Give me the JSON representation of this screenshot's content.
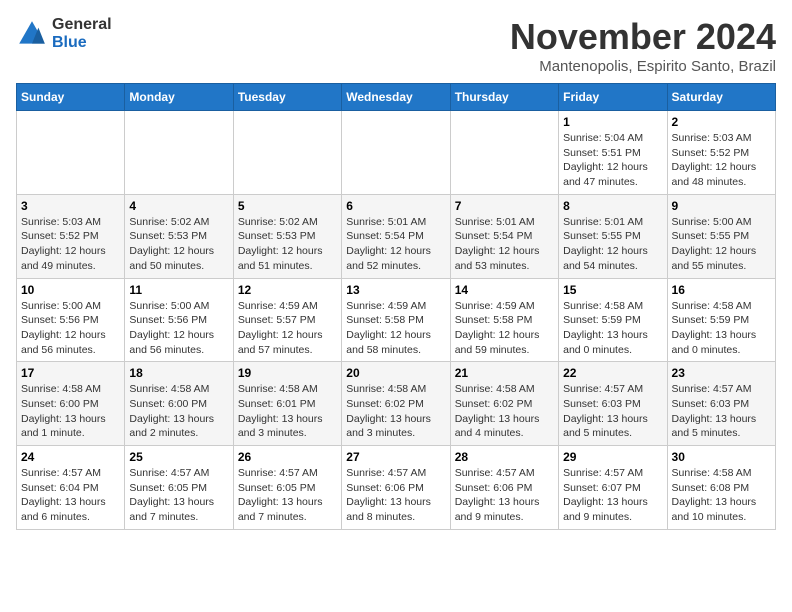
{
  "logo": {
    "general": "General",
    "blue": "Blue"
  },
  "title": {
    "month": "November 2024",
    "location": "Mantenopolis, Espirito Santo, Brazil"
  },
  "weekdays": [
    "Sunday",
    "Monday",
    "Tuesday",
    "Wednesday",
    "Thursday",
    "Friday",
    "Saturday"
  ],
  "weeks": [
    [
      {
        "day": "",
        "info": ""
      },
      {
        "day": "",
        "info": ""
      },
      {
        "day": "",
        "info": ""
      },
      {
        "day": "",
        "info": ""
      },
      {
        "day": "",
        "info": ""
      },
      {
        "day": "1",
        "info": "Sunrise: 5:04 AM\nSunset: 5:51 PM\nDaylight: 12 hours and 47 minutes."
      },
      {
        "day": "2",
        "info": "Sunrise: 5:03 AM\nSunset: 5:52 PM\nDaylight: 12 hours and 48 minutes."
      }
    ],
    [
      {
        "day": "3",
        "info": "Sunrise: 5:03 AM\nSunset: 5:52 PM\nDaylight: 12 hours and 49 minutes."
      },
      {
        "day": "4",
        "info": "Sunrise: 5:02 AM\nSunset: 5:53 PM\nDaylight: 12 hours and 50 minutes."
      },
      {
        "day": "5",
        "info": "Sunrise: 5:02 AM\nSunset: 5:53 PM\nDaylight: 12 hours and 51 minutes."
      },
      {
        "day": "6",
        "info": "Sunrise: 5:01 AM\nSunset: 5:54 PM\nDaylight: 12 hours and 52 minutes."
      },
      {
        "day": "7",
        "info": "Sunrise: 5:01 AM\nSunset: 5:54 PM\nDaylight: 12 hours and 53 minutes."
      },
      {
        "day": "8",
        "info": "Sunrise: 5:01 AM\nSunset: 5:55 PM\nDaylight: 12 hours and 54 minutes."
      },
      {
        "day": "9",
        "info": "Sunrise: 5:00 AM\nSunset: 5:55 PM\nDaylight: 12 hours and 55 minutes."
      }
    ],
    [
      {
        "day": "10",
        "info": "Sunrise: 5:00 AM\nSunset: 5:56 PM\nDaylight: 12 hours and 56 minutes."
      },
      {
        "day": "11",
        "info": "Sunrise: 5:00 AM\nSunset: 5:56 PM\nDaylight: 12 hours and 56 minutes."
      },
      {
        "day": "12",
        "info": "Sunrise: 4:59 AM\nSunset: 5:57 PM\nDaylight: 12 hours and 57 minutes."
      },
      {
        "day": "13",
        "info": "Sunrise: 4:59 AM\nSunset: 5:58 PM\nDaylight: 12 hours and 58 minutes."
      },
      {
        "day": "14",
        "info": "Sunrise: 4:59 AM\nSunset: 5:58 PM\nDaylight: 12 hours and 59 minutes."
      },
      {
        "day": "15",
        "info": "Sunrise: 4:58 AM\nSunset: 5:59 PM\nDaylight: 13 hours and 0 minutes."
      },
      {
        "day": "16",
        "info": "Sunrise: 4:58 AM\nSunset: 5:59 PM\nDaylight: 13 hours and 0 minutes."
      }
    ],
    [
      {
        "day": "17",
        "info": "Sunrise: 4:58 AM\nSunset: 6:00 PM\nDaylight: 13 hours and 1 minute."
      },
      {
        "day": "18",
        "info": "Sunrise: 4:58 AM\nSunset: 6:00 PM\nDaylight: 13 hours and 2 minutes."
      },
      {
        "day": "19",
        "info": "Sunrise: 4:58 AM\nSunset: 6:01 PM\nDaylight: 13 hours and 3 minutes."
      },
      {
        "day": "20",
        "info": "Sunrise: 4:58 AM\nSunset: 6:02 PM\nDaylight: 13 hours and 3 minutes."
      },
      {
        "day": "21",
        "info": "Sunrise: 4:58 AM\nSunset: 6:02 PM\nDaylight: 13 hours and 4 minutes."
      },
      {
        "day": "22",
        "info": "Sunrise: 4:57 AM\nSunset: 6:03 PM\nDaylight: 13 hours and 5 minutes."
      },
      {
        "day": "23",
        "info": "Sunrise: 4:57 AM\nSunset: 6:03 PM\nDaylight: 13 hours and 5 minutes."
      }
    ],
    [
      {
        "day": "24",
        "info": "Sunrise: 4:57 AM\nSunset: 6:04 PM\nDaylight: 13 hours and 6 minutes."
      },
      {
        "day": "25",
        "info": "Sunrise: 4:57 AM\nSunset: 6:05 PM\nDaylight: 13 hours and 7 minutes."
      },
      {
        "day": "26",
        "info": "Sunrise: 4:57 AM\nSunset: 6:05 PM\nDaylight: 13 hours and 7 minutes."
      },
      {
        "day": "27",
        "info": "Sunrise: 4:57 AM\nSunset: 6:06 PM\nDaylight: 13 hours and 8 minutes."
      },
      {
        "day": "28",
        "info": "Sunrise: 4:57 AM\nSunset: 6:06 PM\nDaylight: 13 hours and 9 minutes."
      },
      {
        "day": "29",
        "info": "Sunrise: 4:57 AM\nSunset: 6:07 PM\nDaylight: 13 hours and 9 minutes."
      },
      {
        "day": "30",
        "info": "Sunrise: 4:58 AM\nSunset: 6:08 PM\nDaylight: 13 hours and 10 minutes."
      }
    ]
  ]
}
